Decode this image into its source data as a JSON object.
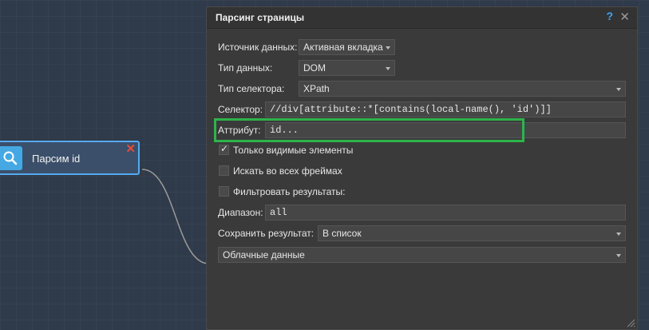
{
  "node": {
    "label": "Парсим id",
    "icon": "search-icon",
    "close": "✕"
  },
  "dialog": {
    "title": "Парсинг страницы",
    "help": "?",
    "close": "✕",
    "source": {
      "label": "Источник данных:",
      "value": "Активная вкладка"
    },
    "data_type": {
      "label": "Тип данных:",
      "value": "DOM"
    },
    "selector_type": {
      "label": "Тип селектора:",
      "value": "XPath"
    },
    "selector": {
      "label": "Селектор:",
      "value": "//div[attribute::*[contains(local-name(), 'id')]]"
    },
    "attribute": {
      "label": "Аттрибут:",
      "value": "id..."
    },
    "only_visible": {
      "label": "Только видимые элементы",
      "checked": true
    },
    "all_frames": {
      "label": "Искать во всех фреймах",
      "checked": false
    },
    "filter": {
      "label": "Фильтровать результаты:",
      "checked": false
    },
    "range": {
      "label": "Диапазон:",
      "value": "all"
    },
    "save_result": {
      "label": "Сохранить результат:",
      "value": "В список"
    },
    "cloud": {
      "value": "Облачные данные"
    }
  },
  "colors": {
    "highlight": "#2eb34a",
    "node_border": "#55aaf0",
    "help": "#4aa3e8",
    "node_close": "#e74c3c"
  }
}
